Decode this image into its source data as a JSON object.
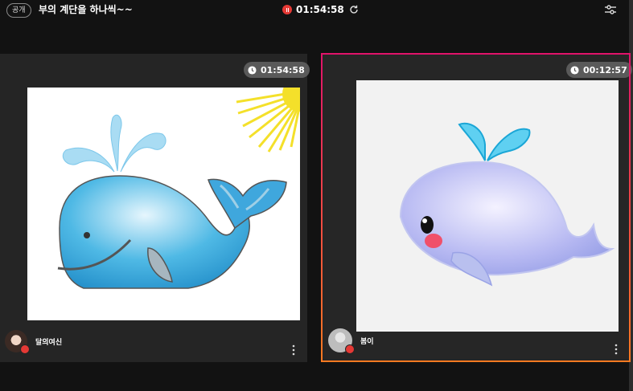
{
  "header": {
    "badge": "공개",
    "title": "부의 계단을 하나씩~~",
    "recording_time": "01:54:58"
  },
  "participants": [
    {
      "name": "달의여신",
      "timer": "01:54:58"
    },
    {
      "name": "봄이",
      "timer": "00:12:57"
    }
  ],
  "colors": {
    "accent_top": "#e0136a",
    "accent_bottom": "#ff7a21",
    "mic_red": "#e53935"
  },
  "icons": [
    "record-icon",
    "refresh-icon",
    "settings-icon",
    "clock-icon",
    "mic-icon",
    "more-icon"
  ]
}
